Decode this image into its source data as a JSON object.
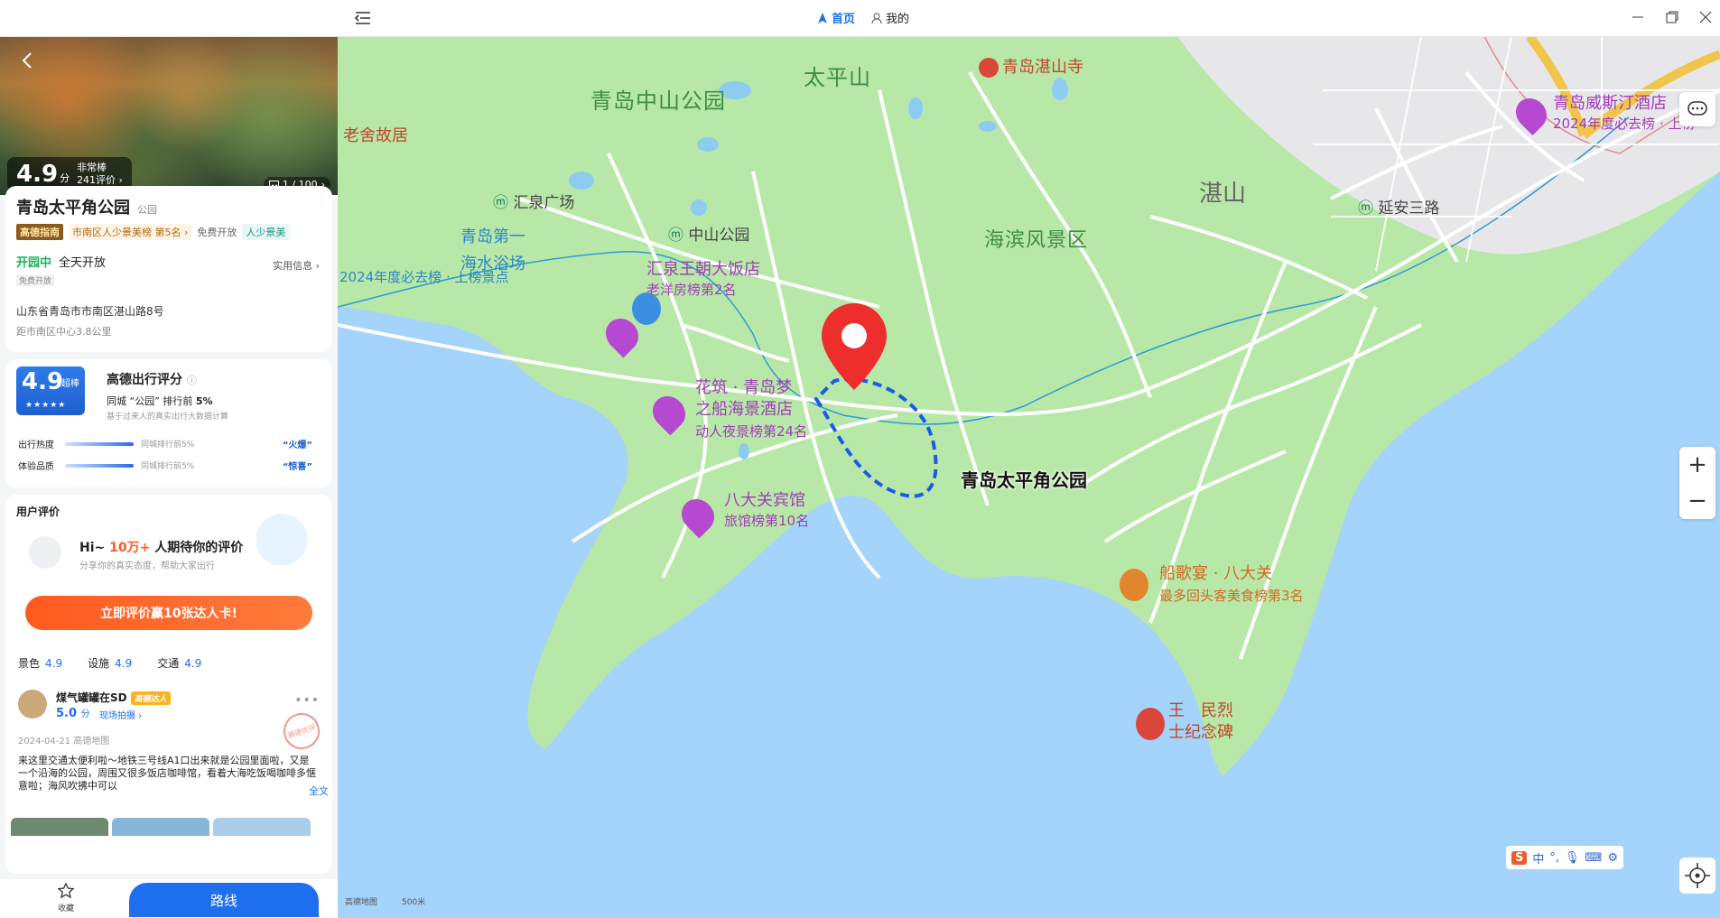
{
  "topbar": {
    "tabs": [
      {
        "label": "首页",
        "active": true
      },
      {
        "label": "我的",
        "active": false
      }
    ]
  },
  "hero": {
    "score": "4.9",
    "score_unit": "分",
    "score_word": "非常棒",
    "review_count": "241评价",
    "photo_counter": "1 / 100"
  },
  "poi": {
    "name": "青岛太平角公园",
    "category": "公园",
    "tags": {
      "guide": "高德指南",
      "rank": "市南区人少景美榜 第5名",
      "free": "免费开放",
      "few_people": "人少景美"
    },
    "open_status": "开园中",
    "open_hours": "全天开放",
    "open_sub": "免费开放",
    "info_link": "实用信息",
    "address": "山东省青岛市市南区湛山路8号",
    "distance": "距市南区中心3.8公里"
  },
  "score": {
    "value": "4.9",
    "level": "超棒",
    "title": "高德出行评分",
    "rank_prefix": "同城 “公园” 排行前",
    "rank_value": "5%",
    "note": "基于过来人的真实出行大数据计算",
    "metrics": [
      {
        "label": "出行热度",
        "sub": "同城排行前5%",
        "value": "“火爆”"
      },
      {
        "label": "体验品质",
        "sub": "同城排行前5%",
        "value": "“惊喜”"
      }
    ]
  },
  "reviews": {
    "title": "用户评价",
    "hi_prefix": "Hi~",
    "hi_count": "10万+",
    "hi_suffix": "人期待你的评价",
    "hi_sub": "分享你的真实态度，帮助大家出行",
    "cta": "立即评价赢10张达人卡!",
    "subscores": [
      {
        "label": "景色",
        "value": "4.9"
      },
      {
        "label": "设施",
        "value": "4.9"
      },
      {
        "label": "交通",
        "value": "4.9"
      }
    ],
    "item": {
      "user": "煤气罐罐在SD",
      "badge": "高德达人",
      "score": "5.0",
      "score_unit": "分",
      "photo_tag": "现场拍摄",
      "date": "2024-04-21 高德地图",
      "stamp": "高德优评",
      "body": "来这里交通太便利啦～地铁三号线A1口出来就是公园里面啦，又是一个沿海的公园，周围又很多饭店咖啡馆，看着大海吃饭喝咖啡多惬意啦；海风吹拂中可以",
      "full": "全文"
    }
  },
  "bottom": {
    "fav_label": "收藏",
    "route_label": "路线"
  },
  "map": {
    "labels": {
      "taiping_mountain": "太平山",
      "zhanshan_temple": "青岛湛山寺",
      "zhongshan_park": "青岛中山公园",
      "laoshe": "老舍故居",
      "huiquan_square": "汇泉广场",
      "zhongshan_metro": "中山公园",
      "beach_line1": "青岛第一",
      "beach_line2": "海水浴场",
      "beach_sub": "2024年度必去榜 · 上榜景点",
      "hotel1": "汇泉王朝大饭店",
      "hotel1_sub": "老洋房榜第2名",
      "hotel2_line1": "花筑 · 青岛梦",
      "hotel2_line2": "之船海景酒店",
      "hotel2_sub": "动人夜景榜第24名",
      "hotel3": "八大关宾馆",
      "hotel3_sub": "旅馆榜第10名",
      "scenic": "海滨风景区",
      "zhanshan": "湛山",
      "yanan": "延安三路",
      "westin": "青岛威斯汀酒店",
      "westin_sub": "2024年度必去榜 · 上榜",
      "restaurant": "船歌宴 · 八大关",
      "restaurant_sub": "最多回头客美食榜第3名",
      "memorial_line1": "王　民烈",
      "memorial_line2": "士纪念碑",
      "main": "青岛太平角公园"
    },
    "scale": "高德地图　　　500米",
    "ime": [
      "中",
      "°,"
    ]
  }
}
